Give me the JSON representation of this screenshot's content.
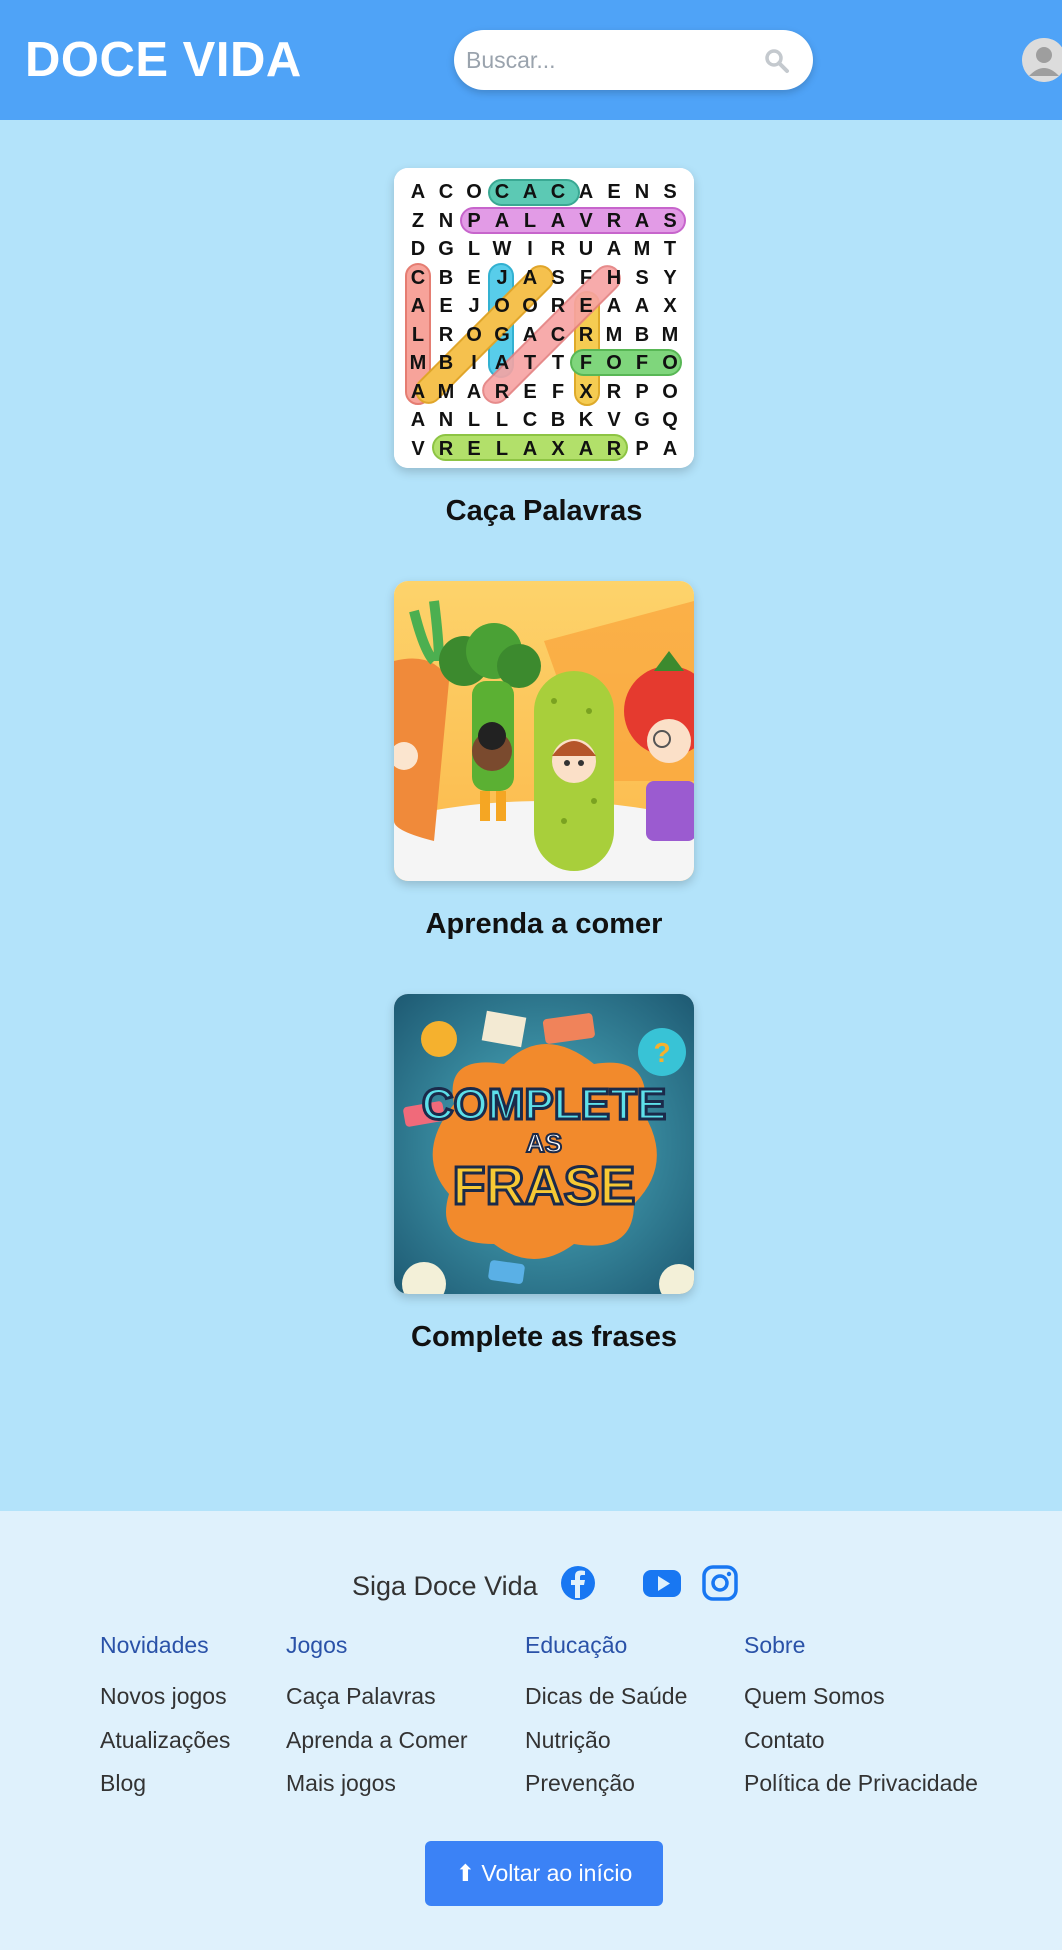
{
  "header": {
    "logo": "DOCE VIDA",
    "search_placeholder": "Buscar...",
    "brand_color": "#4fa3f7"
  },
  "games": [
    {
      "title": "Caça Palavras",
      "grid": [
        [
          "A",
          "C",
          "O",
          "C",
          "A",
          "C",
          "A",
          "E",
          "N",
          "S"
        ],
        [
          "Z",
          "N",
          "P",
          "A",
          "L",
          "A",
          "V",
          "R",
          "A",
          "S"
        ],
        [
          "D",
          "G",
          "L",
          "W",
          "I",
          "R",
          "U",
          "A",
          "M",
          "T"
        ],
        [
          "C",
          "B",
          "E",
          "J",
          "A",
          "S",
          "F",
          "H",
          "S",
          "Y"
        ],
        [
          "A",
          "E",
          "J",
          "O",
          "O",
          "R",
          "E",
          "A",
          "A",
          "X"
        ],
        [
          "L",
          "R",
          "O",
          "G",
          "A",
          "C",
          "R",
          "M",
          "B",
          "M"
        ],
        [
          "M",
          "B",
          "I",
          "A",
          "T",
          "T",
          "F",
          "O",
          "F",
          "O"
        ],
        [
          "A",
          "M",
          "A",
          "R",
          "E",
          "F",
          "X",
          "R",
          "P",
          "O"
        ],
        [
          "A",
          "N",
          "L",
          "L",
          "C",
          "B",
          "K",
          "V",
          "G",
          "Q"
        ],
        [
          "V",
          "R",
          "E",
          "L",
          "A",
          "X",
          "A",
          "R",
          "P",
          "A"
        ]
      ]
    },
    {
      "title": "Aprenda a comer"
    },
    {
      "title": "Complete as frases",
      "image_text": [
        "COMPLETE",
        "AS",
        "FRASE"
      ]
    }
  ],
  "footer": {
    "follow_label": "Siga Doce Vida",
    "social_icons": [
      "facebook-icon",
      "youtube-icon",
      "instagram-icon"
    ],
    "columns": [
      {
        "heading": "Novidades",
        "links": [
          "Novos jogos",
          "Atualizações",
          "Blog"
        ]
      },
      {
        "heading": "Jogos",
        "links": [
          "Caça Palavras",
          "Aprenda a Comer",
          "Mais jogos"
        ]
      },
      {
        "heading": "Educação",
        "links": [
          "Dicas de Saúde",
          "Nutrição",
          "Prevenção"
        ]
      },
      {
        "heading": "Sobre",
        "links": [
          "Quem Somos",
          "Contato",
          "Política de Privacidade"
        ]
      }
    ],
    "back_to_top": "⬆ Voltar ao início"
  }
}
